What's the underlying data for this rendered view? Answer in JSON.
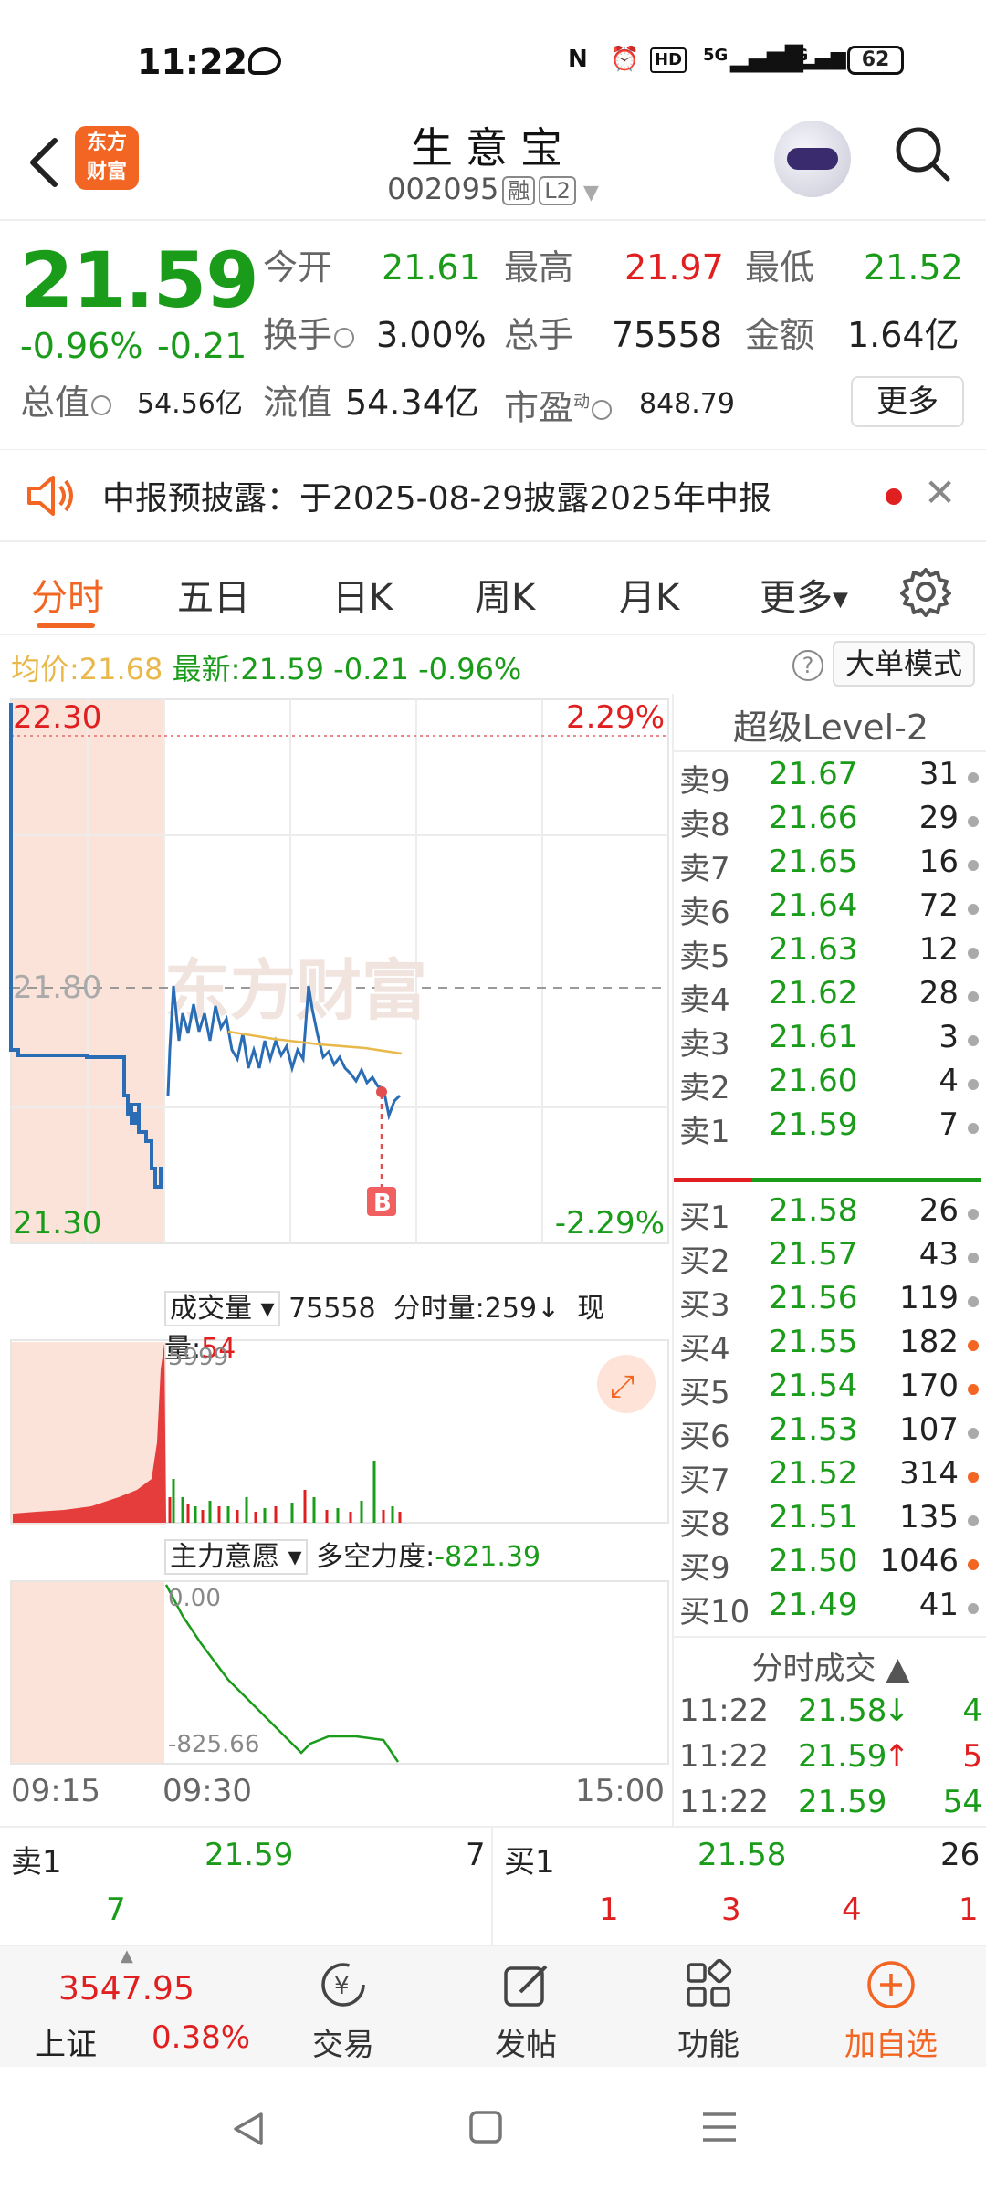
{
  "status_bar": {
    "time": "11:22",
    "battery": "62",
    "signal1": "5G",
    "signal2": "4G",
    "hd": "HD"
  },
  "header": {
    "title": "生意宝",
    "code": "002095",
    "tag1": "融",
    "tag2": "L2",
    "logo_line1": "东方",
    "logo_line2": "财富"
  },
  "quote": {
    "price": "21.59",
    "change_pct": "-0.96%",
    "change": "-0.21",
    "open_label": "今开",
    "open": "21.61",
    "high_label": "最高",
    "high": "21.97",
    "low_label": "最低",
    "low": "21.52",
    "turnover_label": "换手",
    "turnover": "3.00%",
    "volume_label": "总手",
    "volume": "75558",
    "amount_label": "金额",
    "amount": "1.64亿",
    "mktcap_label": "总值",
    "mktcap": "54.56亿",
    "float_label": "流值",
    "float": "54.34亿",
    "pe_label": "市盈",
    "pe_sup": "动",
    "pe": "848.79",
    "more": "更多"
  },
  "notice": {
    "text": "中报预披露：于2025-08-29披露2025年中报"
  },
  "tabs": [
    "分时",
    "五日",
    "日K",
    "周K",
    "月K",
    "更多"
  ],
  "avg_bar": {
    "avg_label": "均价:",
    "avg": "21.68",
    "latest_label": "最新:",
    "latest": "21.59",
    "chg": "-0.21",
    "pct": "-0.96%",
    "mode_btn": "大单模式"
  },
  "chart": {
    "top_left": "22.30",
    "top_right": "2.29%",
    "mid": "21.80",
    "bot_left": "21.30",
    "bot_right": "-2.29%",
    "marker": "B",
    "watermark": "东方财富",
    "vol_label": "成交量",
    "vol_total": "75558",
    "vol_min_label": "分时量:259",
    "vol_cur_label": "现量:",
    "vol_cur": "54",
    "vol_max": "5999",
    "force_label": "主力意愿",
    "force_label2": "多空力度:",
    "force_val": "-821.39",
    "force_top": "0.00",
    "force_bot": "-825.66",
    "time_start": "09:15",
    "time_open": "09:30",
    "time_end": "15:00"
  },
  "orderbook": {
    "title": "超级Level-2",
    "sells": [
      {
        "label": "卖9",
        "price": "21.67",
        "vol": "31",
        "dot": "g"
      },
      {
        "label": "卖8",
        "price": "21.66",
        "vol": "29",
        "dot": "g"
      },
      {
        "label": "卖7",
        "price": "21.65",
        "vol": "16",
        "dot": "g"
      },
      {
        "label": "卖6",
        "price": "21.64",
        "vol": "72",
        "dot": "g"
      },
      {
        "label": "卖5",
        "price": "21.63",
        "vol": "12",
        "dot": "g"
      },
      {
        "label": "卖4",
        "price": "21.62",
        "vol": "28",
        "dot": "g"
      },
      {
        "label": "卖3",
        "price": "21.61",
        "vol": "3",
        "dot": "g"
      },
      {
        "label": "卖2",
        "price": "21.60",
        "vol": "4",
        "dot": "g"
      },
      {
        "label": "卖1",
        "price": "21.59",
        "vol": "7",
        "dot": "g"
      }
    ],
    "buys": [
      {
        "label": "买1",
        "price": "21.58",
        "vol": "26",
        "dot": "g"
      },
      {
        "label": "买2",
        "price": "21.57",
        "vol": "43",
        "dot": "g"
      },
      {
        "label": "买3",
        "price": "21.56",
        "vol": "119",
        "dot": "g"
      },
      {
        "label": "买4",
        "price": "21.55",
        "vol": "182",
        "dot": "o"
      },
      {
        "label": "买5",
        "price": "21.54",
        "vol": "170",
        "dot": "o"
      },
      {
        "label": "买6",
        "price": "21.53",
        "vol": "107",
        "dot": "g"
      },
      {
        "label": "买7",
        "price": "21.52",
        "vol": "314",
        "dot": "o"
      },
      {
        "label": "买8",
        "price": "21.51",
        "vol": "135",
        "dot": "g"
      },
      {
        "label": "买9",
        "price": "21.50",
        "vol": "1046",
        "dot": "o"
      },
      {
        "label": "买10",
        "price": "21.49",
        "vol": "41",
        "dot": "g"
      }
    ],
    "trades_title": "分时成交",
    "trades": [
      {
        "time": "11:22",
        "price": "21.58",
        "arrow": "↓",
        "vol": "4",
        "color": "#1a9c1a"
      },
      {
        "time": "11:22",
        "price": "21.59",
        "arrow": "↑",
        "vol": "5",
        "color": "#e02020"
      },
      {
        "time": "11:22",
        "price": "21.59",
        "arrow": "",
        "vol": "54",
        "color": "#1a9c1a"
      }
    ]
  },
  "quote_bar": {
    "sell_label": "卖1",
    "sell_price": "21.59",
    "sell_vol": "7",
    "sell_q": [
      "7"
    ],
    "buy_label": "买1",
    "buy_price": "21.58",
    "buy_vol": "26",
    "buy_q": [
      "1",
      "3",
      "4",
      "1"
    ]
  },
  "footer": {
    "index_value": "3547.95",
    "index_name": "上证",
    "index_pct": "0.38%",
    "items": [
      "交易",
      "发帖",
      "功能",
      "加自选"
    ]
  },
  "colors": {
    "up": "#e02020",
    "down": "#1a9c1a",
    "accent": "#f26522",
    "line": "#2a6db5",
    "avg": "#e8b84a"
  }
}
